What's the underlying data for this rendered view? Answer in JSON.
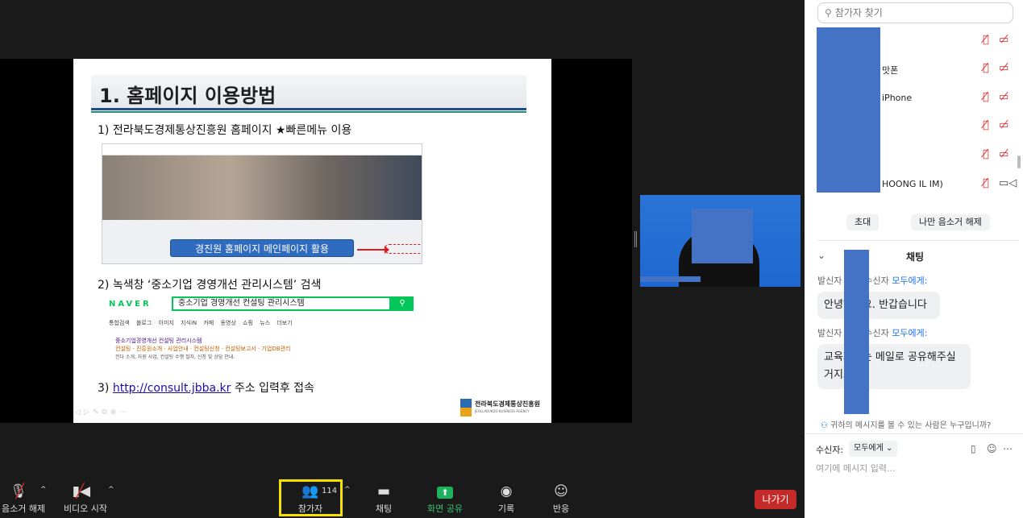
{
  "slide": {
    "title": "1. 홈페이지 이용방법",
    "step1": "1) 전라북도경제통상진흥원 홈페이지 ★빠른메뉴 이용",
    "step1_banner": "경진원 홈페이지 메인페이지 활용",
    "step2": "2) 녹색창 ‘중소기업 경영개선 관리시스템’ 검색",
    "naver_logo": "NAVER",
    "naver_query": "중소기업 경영개선 컨설팅 관리시스템",
    "naver_tabs": "통합검색 블로그 이미지 지식iN 카페 동영상 쇼핑 뉴스 더보기",
    "naver_result_title": "중소기업경영개선 컨설팅 관리시스템",
    "naver_result_tags": "컨설팅 · 진흥원소개 · 사업안내 · 컨설팅신청 · 컨설팅보고서 · 기업DB관리",
    "naver_result_desc": "전다 소개, 자원 사업, 컨설팅 수행 절차, 신청 및 상담 안내.",
    "step3_prefix": "3) ",
    "step3_link": "http://consult.jbba.kr",
    "step3_suffix": " 주소 입력후 접속",
    "logo_name": "전라북도경제통상진흥원",
    "logo_sub": "JEOLLABUKDO BUSINESS AGENCY"
  },
  "toolbar": {
    "mute_label": "음소거 해제",
    "video_label": "비디오 시작",
    "participants_label": "참가자",
    "participants_count": "114",
    "chat_label": "채팅",
    "share_label": "화면 공유",
    "record_label": "기록",
    "reactions_label": "반응",
    "leave_label": "나가기"
  },
  "panel": {
    "search_placeholder": "참가자 찾기",
    "participants": [
      {
        "name": "",
        "color": "#1db38a",
        "camera_on": false
      },
      {
        "name": "맛폰",
        "color": "#2d3a4a",
        "camera_on": false
      },
      {
        "name": "iPhone",
        "color": "#2d3a4a",
        "camera_on": false
      },
      {
        "name": "",
        "color": "#1db38a",
        "camera_on": false
      },
      {
        "name": "",
        "color": "#1db38a",
        "camera_on": false
      },
      {
        "name": "HOONG IL IM)",
        "color": "#8e3fbf",
        "camera_on": true
      }
    ],
    "invite_label": "초대",
    "unmute_me_label": "나만 음소거 해제",
    "chat_title": "채팅",
    "messages": [
      {
        "from": "발신자",
        "to_prefix": "수신자",
        "to": "모두에게:",
        "text": "안녕하세요. 반갑습니다"
      },
      {
        "from": "발신자",
        "to_prefix": "수신자",
        "to": "모두에게:",
        "text": "교육자료는 메일로 공유해주실 거지요?"
      }
    ],
    "who_sees": "귀하의 메시지를 볼 수 있는 사람은 누구입니까?",
    "recipient_label": "수신자:",
    "recipient_value": "모두에게",
    "input_placeholder": "여기에 메시지 입력..."
  }
}
